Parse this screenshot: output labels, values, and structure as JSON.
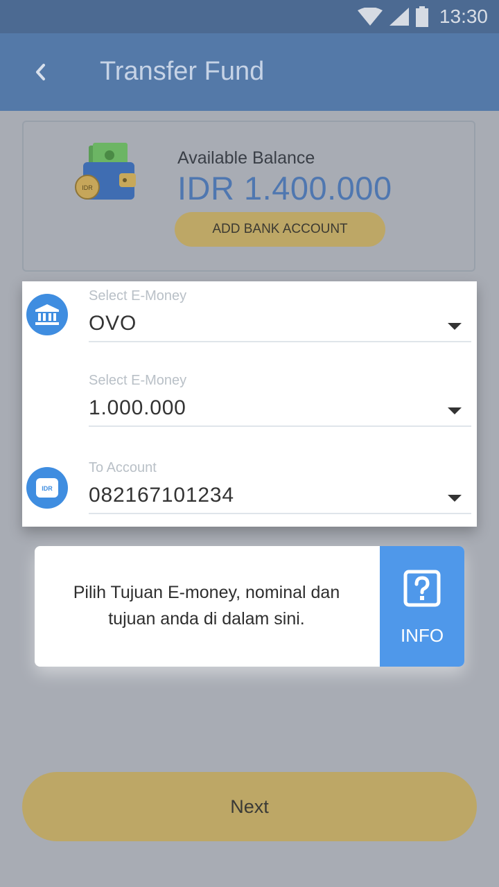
{
  "status_bar": {
    "time": "13:30"
  },
  "header": {
    "title": "Transfer Fund"
  },
  "balance": {
    "label": "Available Balance",
    "amount": "IDR 1.400.000",
    "wallet_badge": "IDR",
    "add_bank_label": "ADD BANK ACCOUNT"
  },
  "form": {
    "emoney": {
      "label": "Select E-Money",
      "value": "OVO"
    },
    "nominal": {
      "label": "Select E-Money",
      "value": "1.000.000"
    },
    "account": {
      "label": "To Account",
      "value": "082167101234"
    },
    "account_badge": "IDR"
  },
  "info": {
    "text": "Pilih Tujuan E-money, nominal dan tujuan anda di dalam sini.",
    "label": "INFO"
  },
  "next_label": "Next",
  "colors": {
    "primary": "#5479a8",
    "accent": "#bda766",
    "info_blue": "#4f98ea"
  }
}
